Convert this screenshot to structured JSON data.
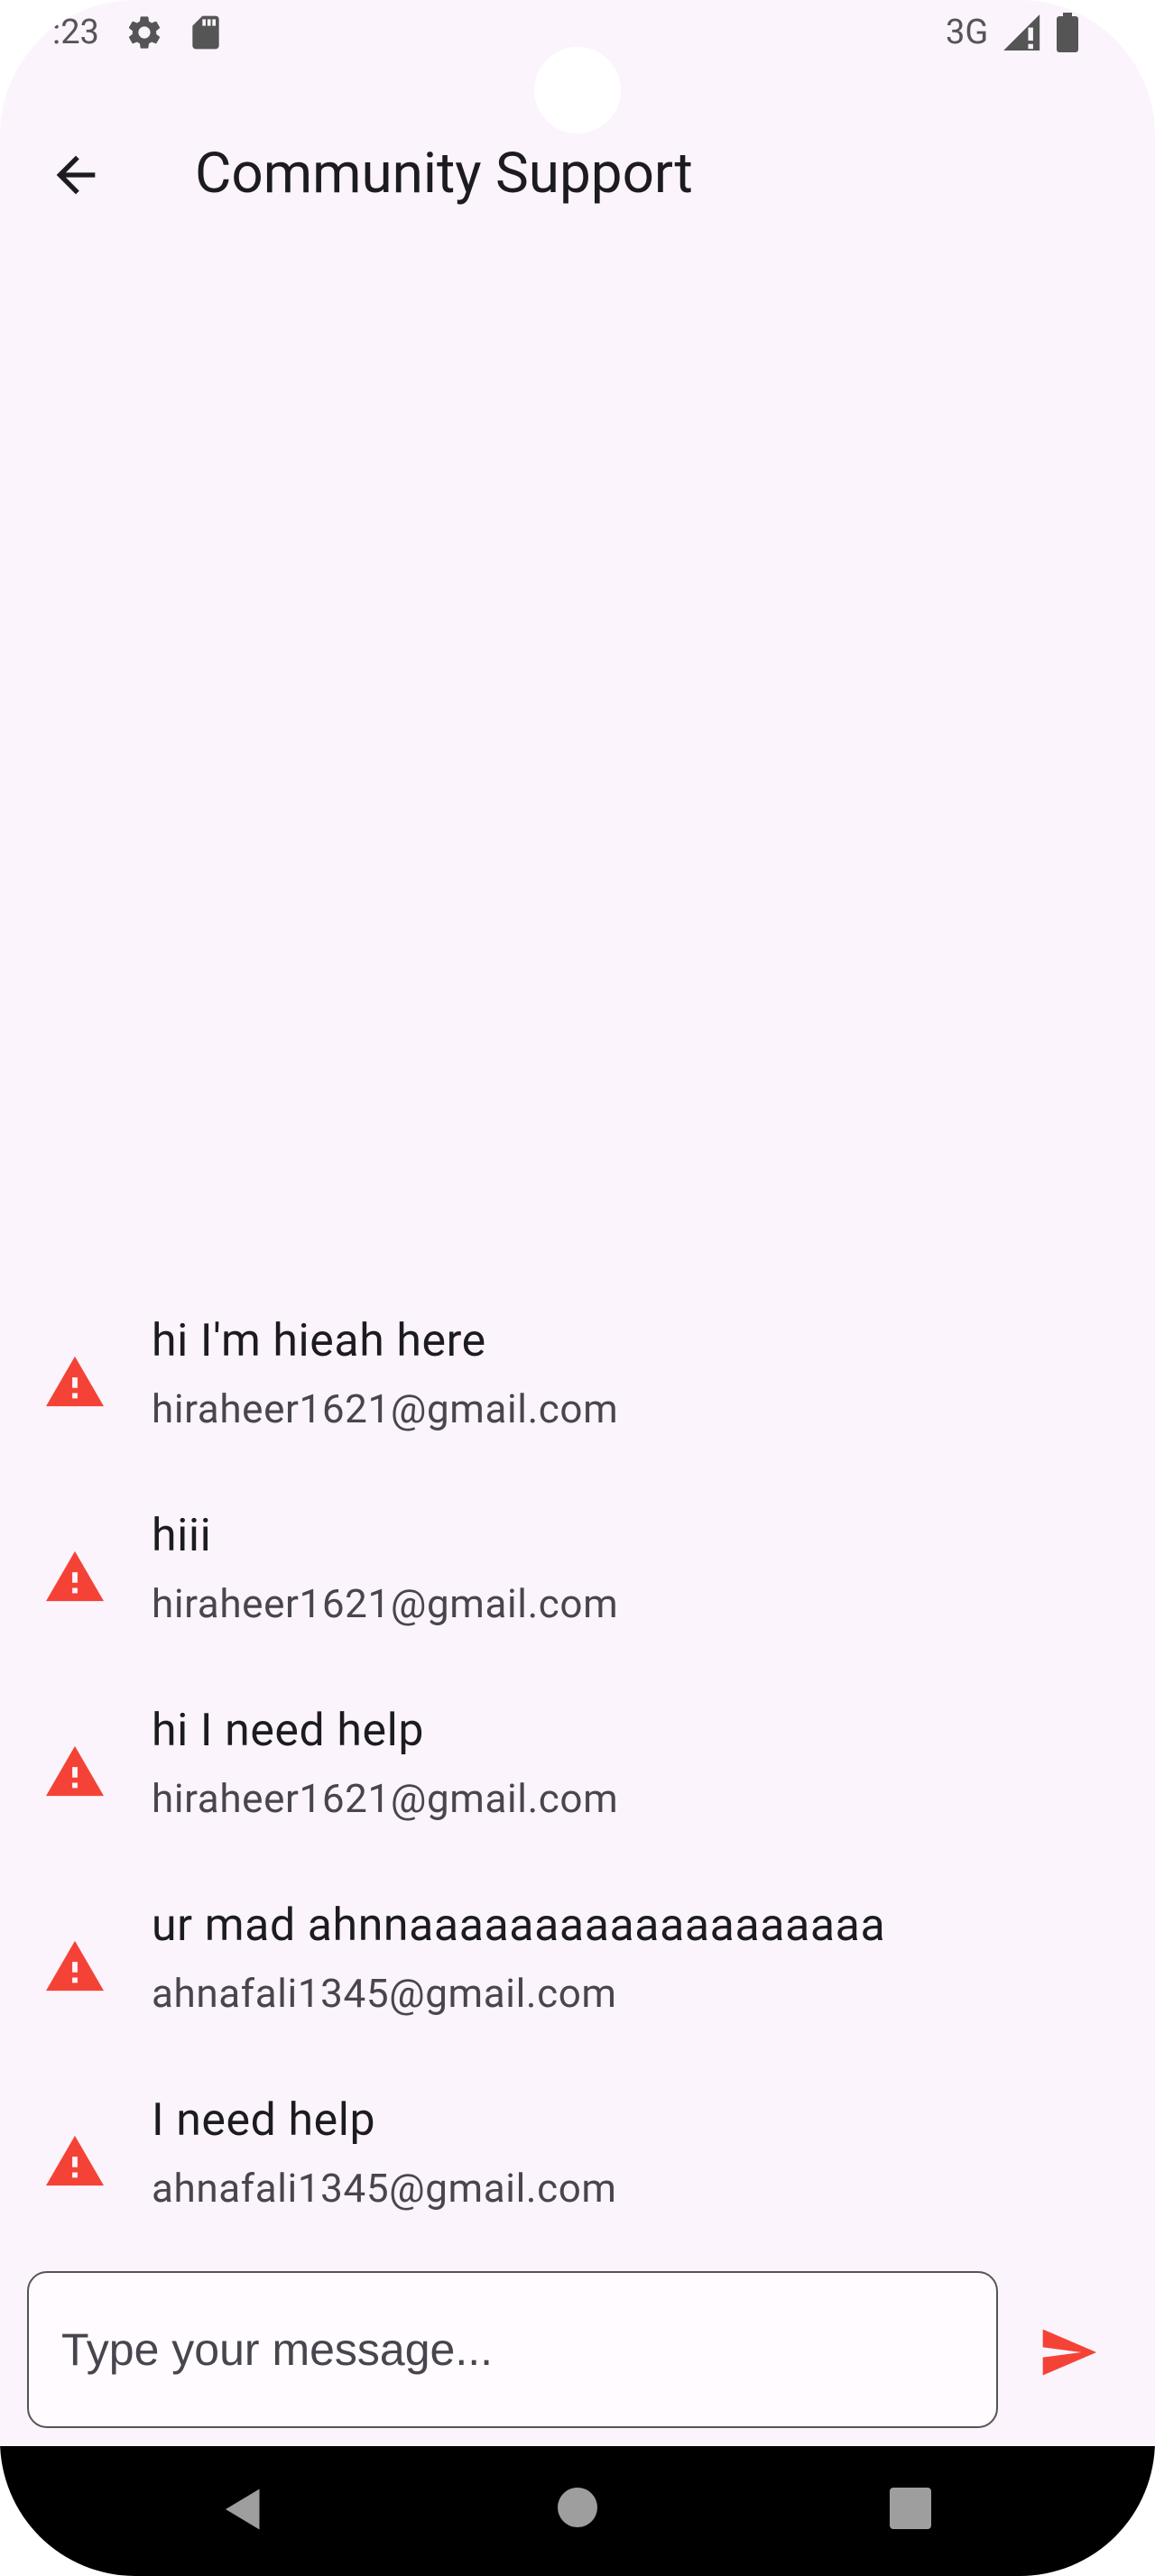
{
  "status_bar": {
    "time": ":23",
    "network": "3G"
  },
  "app_bar": {
    "title": "Community Support",
    "back_icon": "arrow-back-icon"
  },
  "messages": [
    {
      "text": "hi I'm hieah here",
      "email": "hiraheer1621@gmail.com",
      "icon": "warning-icon"
    },
    {
      "text": "hiii",
      "email": "hiraheer1621@gmail.com",
      "icon": "warning-icon"
    },
    {
      "text": "hi I need help",
      "email": "hiraheer1621@gmail.com",
      "icon": "warning-icon"
    },
    {
      "text": "ur mad ahnnaaaaaaaaaaaaaaaaaaa",
      "email": "ahnafali1345@gmail.com",
      "icon": "warning-icon"
    },
    {
      "text": "I need help",
      "email": "ahnafali1345@gmail.com",
      "icon": "warning-icon"
    }
  ],
  "composer": {
    "placeholder": "Type your message...",
    "value": "",
    "send_icon": "send-icon"
  },
  "colors": {
    "background": "#fcf4fc",
    "accent": "#f44336",
    "text_primary": "#1c1b1f",
    "text_secondary": "#49454f"
  }
}
